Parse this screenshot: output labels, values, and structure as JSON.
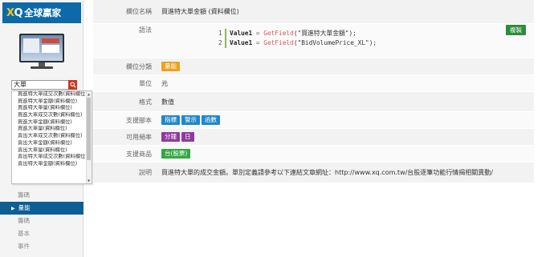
{
  "logo": {
    "mark": "XQ",
    "text": "全球贏家"
  },
  "search": {
    "value": "大單"
  },
  "dropdown_items": [
    "買進特大單成交次數(資料欄位)",
    "買進特大單金額(資料欄位)",
    "買進特大單量(資料欄位)",
    "買進大單成交次數(資料欄位)",
    "買進大單金額(資料欄位)",
    "買進大單量(資料欄位)",
    "賣出大單成交次數(資料欄位)",
    "賣出大單金額(資料欄位)",
    "賣出大單量(資料欄位)",
    "賣出特大單成交次數(資料欄位)",
    "賣出特大單金額(資料欄位)"
  ],
  "sidebar": {
    "items": [
      {
        "label": "籌碼",
        "active": false
      },
      {
        "label": "量能",
        "active": true
      },
      {
        "label": "籌碼",
        "active": false
      },
      {
        "label": "基本",
        "active": false
      },
      {
        "label": "事件",
        "active": false
      }
    ]
  },
  "detail": {
    "name_label": "欄位名稱",
    "name_value": "買進特大單金額 (資料欄位)",
    "syntax_label": "語法",
    "copy_label": "複製",
    "code": [
      {
        "n": "1",
        "var": "Value1",
        "op": " = ",
        "fn": "GetField",
        "arg": "(\"買進特大單金額\");"
      },
      {
        "n": "2",
        "var": "Value1",
        "op": " = ",
        "fn": "GetField",
        "arg": "(\"BidVolumePrice_XL\");"
      }
    ],
    "category_label": "欄位分類",
    "category_tag": "量能",
    "unit_label": "單位",
    "unit_value": "元",
    "format_label": "格式",
    "format_value": "數值",
    "script_label": "支援腳本",
    "script_tags": [
      "指標",
      "警示",
      "函數"
    ],
    "freq_label": "可用頻率",
    "freq_tags": [
      "分鐘",
      "日"
    ],
    "product_label": "支援商品",
    "product_tag": "台(股票)",
    "desc_label": "說明",
    "desc_value": "買進特大單的成交金額。單別定義請參考以下連結文章網址：http://www.xq.com.tw/台股逐筆功能行情揭相關異動/"
  },
  "colors": {
    "brand": "#0d6aa9",
    "active_nav": "#0d5f93",
    "copy": "#2c8c3a",
    "category": "#e9a222",
    "script": "#1f88c9",
    "freq": "#8e3a9f",
    "product": "#32a840"
  }
}
